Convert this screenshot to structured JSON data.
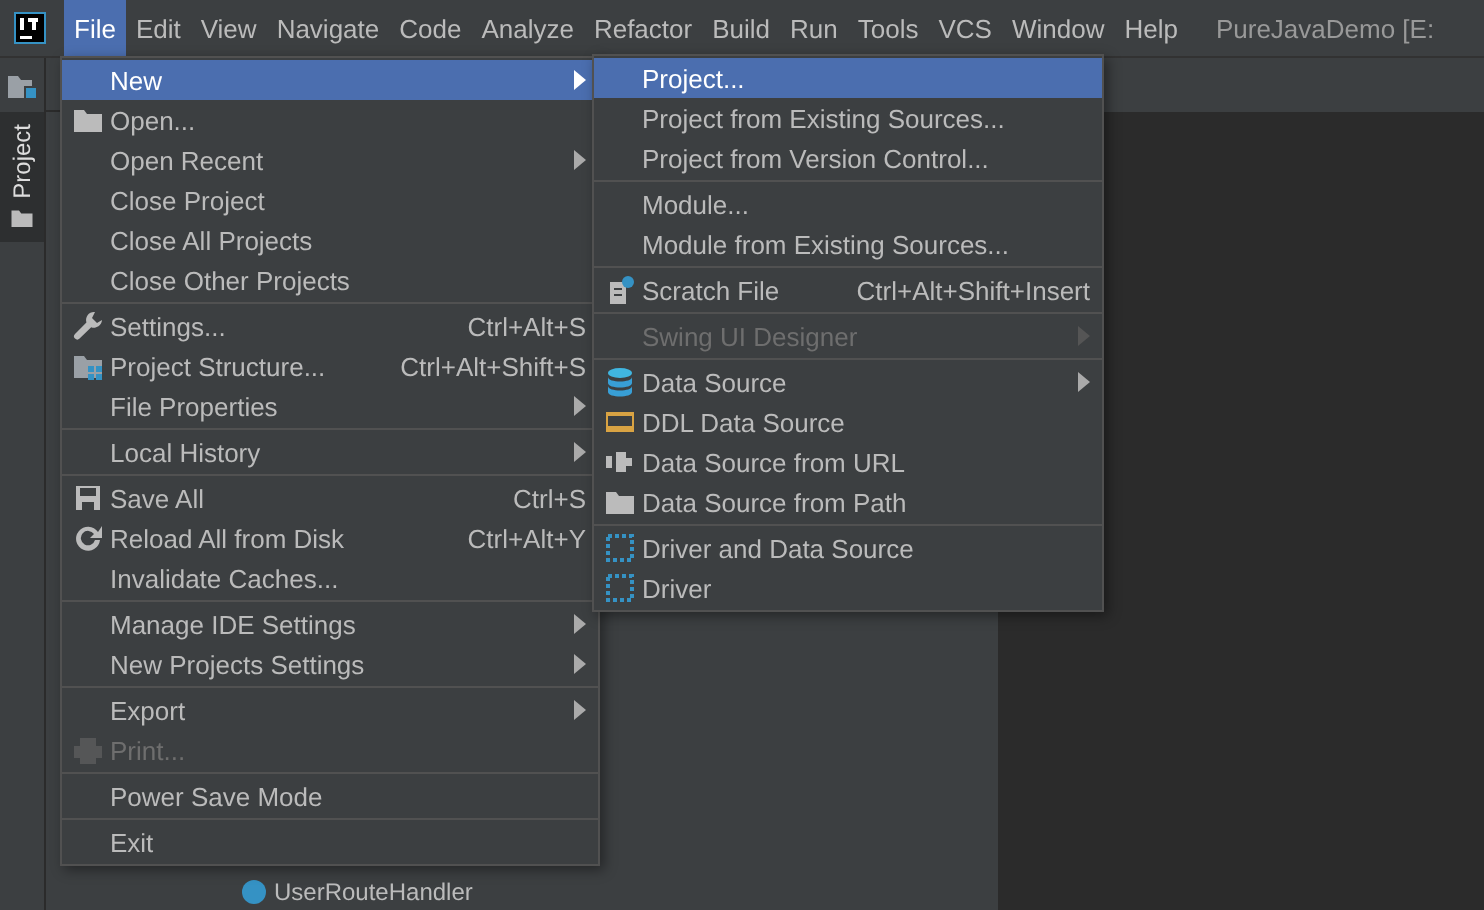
{
  "menubar": [
    {
      "label": "File",
      "selected": true
    },
    {
      "label": "Edit",
      "selected": false
    },
    {
      "label": "View",
      "selected": false
    },
    {
      "label": "Navigate",
      "selected": false
    },
    {
      "label": "Code",
      "selected": false
    },
    {
      "label": "Analyze",
      "selected": false
    },
    {
      "label": "Refactor",
      "selected": false
    },
    {
      "label": "Build",
      "selected": false
    },
    {
      "label": "Run",
      "selected": false
    },
    {
      "label": "Tools",
      "selected": false
    },
    {
      "label": "VCS",
      "selected": false
    },
    {
      "label": "Window",
      "selected": false
    },
    {
      "label": "Help",
      "selected": false
    }
  ],
  "window": {
    "title": "PureJavaDemo [E:"
  },
  "tool_window_tab": {
    "label": "Project",
    "selected": false
  },
  "project_tree": {
    "partial_row": "UserRouteHandler"
  },
  "file_menu": [
    {
      "kind": "item",
      "label": "New",
      "submenu": true,
      "selected": true,
      "disabled": false
    },
    {
      "kind": "item",
      "label": "Open...",
      "submenu": false,
      "selected": false,
      "disabled": false
    },
    {
      "kind": "item",
      "label": "Open Recent",
      "submenu": true,
      "selected": false,
      "disabled": false
    },
    {
      "kind": "item",
      "label": "Close Project",
      "submenu": false,
      "selected": false,
      "disabled": false
    },
    {
      "kind": "item",
      "label": "Close All Projects",
      "submenu": false,
      "selected": false,
      "disabled": false
    },
    {
      "kind": "item",
      "label": "Close Other Projects",
      "submenu": false,
      "selected": false,
      "disabled": false
    },
    {
      "kind": "separator"
    },
    {
      "kind": "item",
      "label": "Settings...",
      "shortcut": "Ctrl+Alt+S",
      "submenu": false,
      "selected": false,
      "disabled": false
    },
    {
      "kind": "item",
      "label": "Project Structure...",
      "shortcut": "Ctrl+Alt+Shift+S",
      "submenu": false,
      "selected": false,
      "disabled": false
    },
    {
      "kind": "item",
      "label": "File Properties",
      "submenu": true,
      "selected": false,
      "disabled": false
    },
    {
      "kind": "separator"
    },
    {
      "kind": "item",
      "label": "Local History",
      "submenu": true,
      "selected": false,
      "disabled": false
    },
    {
      "kind": "separator"
    },
    {
      "kind": "item",
      "label": "Save All",
      "shortcut": "Ctrl+S",
      "submenu": false,
      "selected": false,
      "disabled": false
    },
    {
      "kind": "item",
      "label": "Reload All from Disk",
      "shortcut": "Ctrl+Alt+Y",
      "submenu": false,
      "selected": false,
      "disabled": false
    },
    {
      "kind": "item",
      "label": "Invalidate Caches...",
      "submenu": false,
      "selected": false,
      "disabled": false
    },
    {
      "kind": "separator"
    },
    {
      "kind": "item",
      "label": "Manage IDE Settings",
      "submenu": true,
      "selected": false,
      "disabled": false
    },
    {
      "kind": "item",
      "label": "New Projects Settings",
      "submenu": true,
      "selected": false,
      "disabled": false
    },
    {
      "kind": "separator"
    },
    {
      "kind": "item",
      "label": "Export",
      "submenu": true,
      "selected": false,
      "disabled": false
    },
    {
      "kind": "item",
      "label": "Print...",
      "submenu": false,
      "selected": false,
      "disabled": true
    },
    {
      "kind": "separator"
    },
    {
      "kind": "item",
      "label": "Power Save Mode",
      "submenu": false,
      "selected": false,
      "disabled": false
    },
    {
      "kind": "separator"
    },
    {
      "kind": "item",
      "label": "Exit",
      "submenu": false,
      "selected": false,
      "disabled": false
    }
  ],
  "new_submenu": [
    {
      "kind": "item",
      "label": "Project...",
      "submenu": false,
      "selected": true,
      "disabled": false
    },
    {
      "kind": "item",
      "label": "Project from Existing Sources...",
      "submenu": false,
      "selected": false,
      "disabled": false
    },
    {
      "kind": "item",
      "label": "Project from Version Control...",
      "submenu": false,
      "selected": false,
      "disabled": false
    },
    {
      "kind": "separator"
    },
    {
      "kind": "item",
      "label": "Module...",
      "submenu": false,
      "selected": false,
      "disabled": false
    },
    {
      "kind": "item",
      "label": "Module from Existing Sources...",
      "submenu": false,
      "selected": false,
      "disabled": false
    },
    {
      "kind": "separator"
    },
    {
      "kind": "item",
      "label": "Scratch File",
      "shortcut": "Ctrl+Alt+Shift+Insert",
      "submenu": false,
      "selected": false,
      "disabled": false
    },
    {
      "kind": "separator"
    },
    {
      "kind": "item",
      "label": "Swing UI Designer",
      "submenu": true,
      "selected": false,
      "disabled": true
    },
    {
      "kind": "separator"
    },
    {
      "kind": "item",
      "label": "Data Source",
      "submenu": true,
      "selected": false,
      "disabled": false
    },
    {
      "kind": "item",
      "label": "DDL Data Source",
      "submenu": false,
      "selected": false,
      "disabled": false
    },
    {
      "kind": "item",
      "label": "Data Source from URL",
      "submenu": false,
      "selected": false,
      "disabled": false
    },
    {
      "kind": "item",
      "label": "Data Source from Path",
      "submenu": false,
      "selected": false,
      "disabled": false
    },
    {
      "kind": "separator"
    },
    {
      "kind": "item",
      "label": "Driver and Data Source",
      "submenu": false,
      "selected": false,
      "disabled": false
    },
    {
      "kind": "item",
      "label": "Driver",
      "submenu": false,
      "selected": false,
      "disabled": false
    }
  ]
}
